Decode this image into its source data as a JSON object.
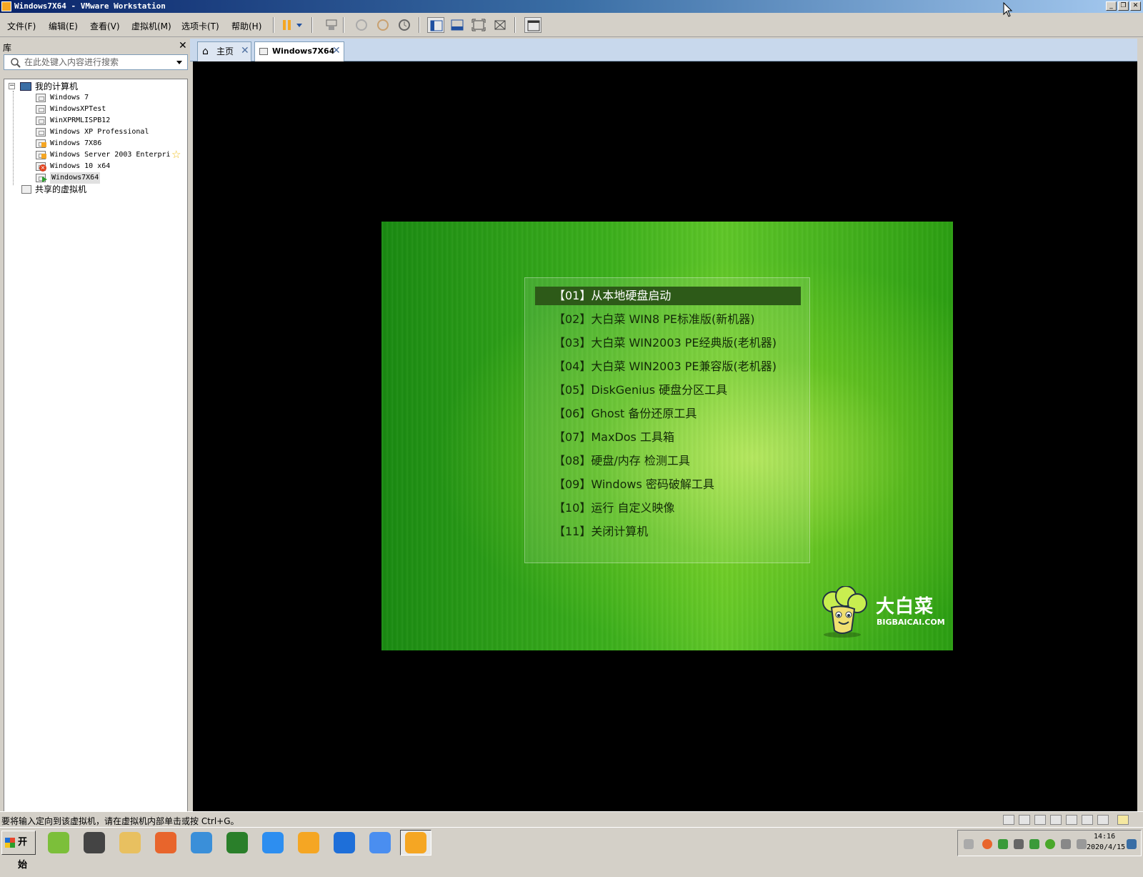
{
  "window": {
    "title": "Windows7X64 - VMware Workstation"
  },
  "menu": [
    "文件(F)",
    "编辑(E)",
    "查看(V)",
    "虚拟机(M)",
    "选项卡(T)",
    "帮助(H)"
  ],
  "toolbar": {
    "icons": [
      "pause-icon",
      "dropdown-icon",
      "send-ctrl-alt-del-icon",
      "snapshot-take-icon",
      "snapshot-revert-icon",
      "snapshot-manager-icon",
      "show-library-icon",
      "thumbnail-bar-icon",
      "fullscreen-icon",
      "unity-icon",
      "console-view-icon"
    ]
  },
  "library": {
    "title": "库",
    "close": "✕",
    "search_placeholder": "在此处键入内容进行搜索",
    "root": "我的计算机",
    "vms": [
      {
        "name": "Windows 7",
        "state": "off"
      },
      {
        "name": "WindowsXPTest",
        "state": "off"
      },
      {
        "name": "WinXPRMLISPB12",
        "state": "off"
      },
      {
        "name": "Windows XP Professional",
        "state": "off"
      },
      {
        "name": "Windows 7X86",
        "state": "paused"
      },
      {
        "name": "Windows Server 2003 Enterpri",
        "state": "paused"
      },
      {
        "name": "Windows 10 x64",
        "state": "error"
      },
      {
        "name": "Windows7X64",
        "state": "running"
      }
    ],
    "shared": "共享的虚拟机"
  },
  "tabs": [
    {
      "label": "主页",
      "close": "✕"
    },
    {
      "label": "Windows7X64",
      "close": "✕"
    }
  ],
  "boot_menu": {
    "items": [
      "【01】从本地硬盘启动",
      "【02】大白菜 WIN8 PE标准版(新机器)",
      "【03】大白菜 WIN2003 PE经典版(老机器)",
      "【04】大白菜 WIN2003 PE兼容版(老机器)",
      "【05】DiskGenius 硬盘分区工具",
      "【06】Ghost 备份还原工具",
      "【07】MaxDos 工具箱",
      "【08】硬盘/内存 检测工具",
      "【09】Windows 密码破解工具",
      "【10】运行 自定义映像",
      "【11】关闭计算机"
    ],
    "selected_index": 0,
    "brand_cn": "大白菜",
    "brand_en": "BIGBAICAI.COM"
  },
  "status": {
    "text": "要将输入定向到该虚拟机，请在虚拟机内部单击或按 Ctrl+G。"
  },
  "taskbar": {
    "start": "开始",
    "apps": [
      {
        "icon": "notepad-plus-icon",
        "color": "#7cbf3a"
      },
      {
        "icon": "camera-icon",
        "color": "#444"
      },
      {
        "icon": "file-explorer-icon",
        "color": "#e8c060"
      },
      {
        "icon": "firefox-icon",
        "color": "#e8652c"
      },
      {
        "icon": "media-player-icon",
        "color": "#3a8fd9"
      },
      {
        "icon": "remote-desktop-icon",
        "color": "#2a7f2a"
      },
      {
        "icon": "baidu-netdisk-icon",
        "color": "#2d8ef0"
      },
      {
        "icon": "kingsoft-icon",
        "color": "#f5a623"
      },
      {
        "icon": "task-view-icon",
        "color": "#1e6fd9"
      },
      {
        "icon": "feishu-icon",
        "color": "#4a8ef0"
      },
      {
        "icon": "vmware-icon",
        "color": "#f5a623"
      }
    ],
    "active_index": 10,
    "clock_time": "14:16",
    "clock_date": "2020/4/15"
  }
}
